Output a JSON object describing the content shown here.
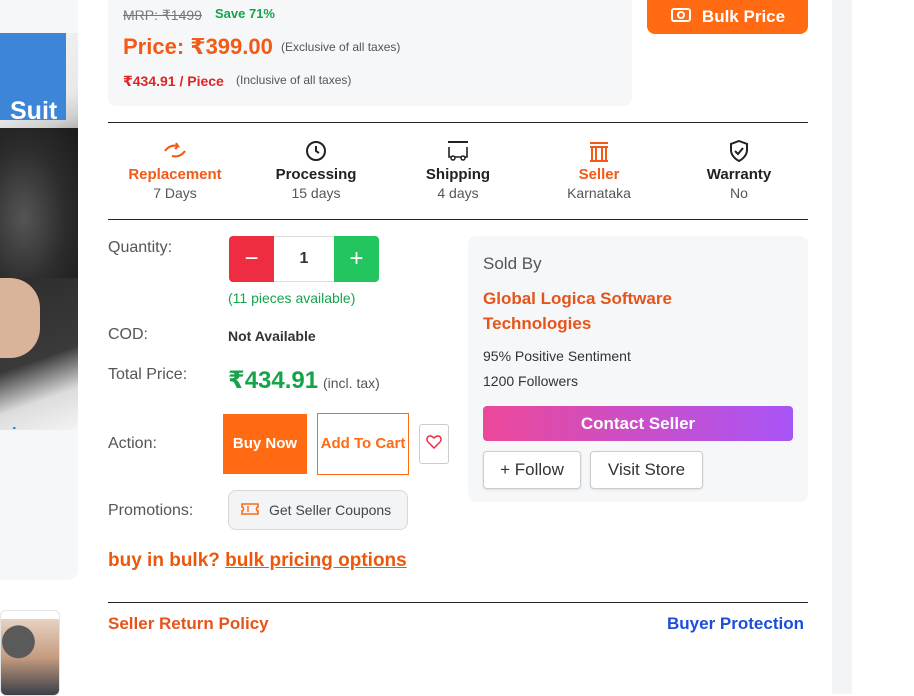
{
  "image_panel": {
    "overlay_text": "Suit",
    "caption_fragment": "ning"
  },
  "pricing": {
    "mrp": "MRP: ₹1499",
    "save": "Save 71%",
    "price": "Price: ₹399.00",
    "price_note": "(Exclusive of all taxes)",
    "per_piece": "₹434.91 / Piece",
    "per_piece_note": "(Inclusive of all taxes)"
  },
  "bulk_price_button": "Bulk Price",
  "features": [
    {
      "title": "Replacement",
      "value": "7 Days",
      "icon": "replacement-icon"
    },
    {
      "title": "Processing",
      "value": "15 days",
      "icon": "clock-icon"
    },
    {
      "title": "Shipping",
      "value": "4 days",
      "icon": "truck-icon"
    },
    {
      "title": "Seller",
      "value": "Karnataka",
      "icon": "store-icon"
    },
    {
      "title": "Warranty",
      "value": "No",
      "icon": "shield-check-icon"
    }
  ],
  "quantity": {
    "label": "Quantity:",
    "value": "1",
    "minus": "−",
    "plus": "+",
    "available": "(11 pieces available)"
  },
  "cod": {
    "label": "COD:",
    "value": "Not Available"
  },
  "total": {
    "label": "Total Price:",
    "value": "₹434.91",
    "note": "(incl. tax)"
  },
  "action": {
    "label": "Action:",
    "buy_now": "Buy Now",
    "add_to_cart": "Add To Cart"
  },
  "promotions": {
    "label": "Promotions:",
    "coupon_button": "Get Seller Coupons"
  },
  "bulk_prompt": {
    "text": "buy in bulk?",
    "link": "bulk pricing options"
  },
  "seller": {
    "sold_by": "Sold By",
    "name": "Global Logica Software Technologies",
    "sentiment": "95% Positive Sentiment",
    "followers": "1200 Followers",
    "contact": "Contact Seller",
    "follow": "+ Follow",
    "visit_store": "Visit Store"
  },
  "footer": {
    "return_policy": "Seller Return Policy",
    "buyer_protection": "Buyer Protection"
  },
  "colors": {
    "accent": "#ff6a13",
    "green": "#16a34a",
    "red": "#dc2626",
    "link_blue": "#1d4ed8"
  }
}
